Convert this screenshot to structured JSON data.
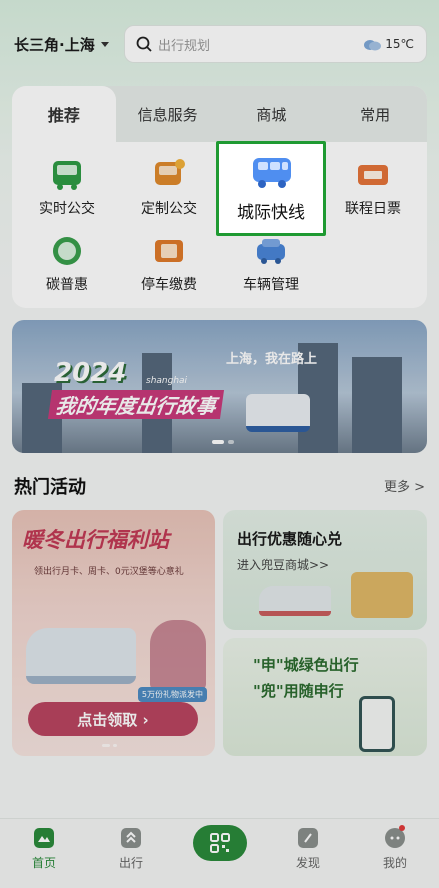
{
  "header": {
    "city": "长三角·上海",
    "search_placeholder": "出行规划",
    "weather": "15℃"
  },
  "tabs": [
    "推荐",
    "信息服务",
    "商城",
    "常用"
  ],
  "services": [
    {
      "label": "实时公交",
      "icon": "bus-icon"
    },
    {
      "label": "定制公交",
      "icon": "custom-bus-icon"
    },
    {
      "label": "城际快线",
      "icon": "intercity-bus-icon"
    },
    {
      "label": "联程日票",
      "icon": "day-ticket-icon"
    },
    {
      "label": "碳普惠",
      "icon": "carbon-icon"
    },
    {
      "label": "停车缴费",
      "icon": "parking-fee-icon"
    },
    {
      "label": "车辆管理",
      "icon": "vehicle-icon"
    }
  ],
  "banner": {
    "year": "2024",
    "title": "我的年度出行故事",
    "tag": "上海，我在路上",
    "sub": "shanghai"
  },
  "hot": {
    "title": "热门活动",
    "more": "更多 >"
  },
  "promo_left": {
    "title": "暖冬出行福利站",
    "sub": "领出行月卡、周卡、0元汉堡等心意礼",
    "badge": "5万份礼物派发中",
    "button": "点击领取 ›"
  },
  "promo_right_top": {
    "title": "出行优惠随心兑",
    "sub": "进入兜豆商城>>"
  },
  "promo_right_bottom": {
    "line1": "\"申\"城绿色出行",
    "line2": "\"兜\"用随申行"
  },
  "nav": [
    "首页",
    "出行",
    "发现",
    "我的"
  ],
  "colors": {
    "accent": "#2a8a3b",
    "highlight_border": "#1f9a32"
  }
}
